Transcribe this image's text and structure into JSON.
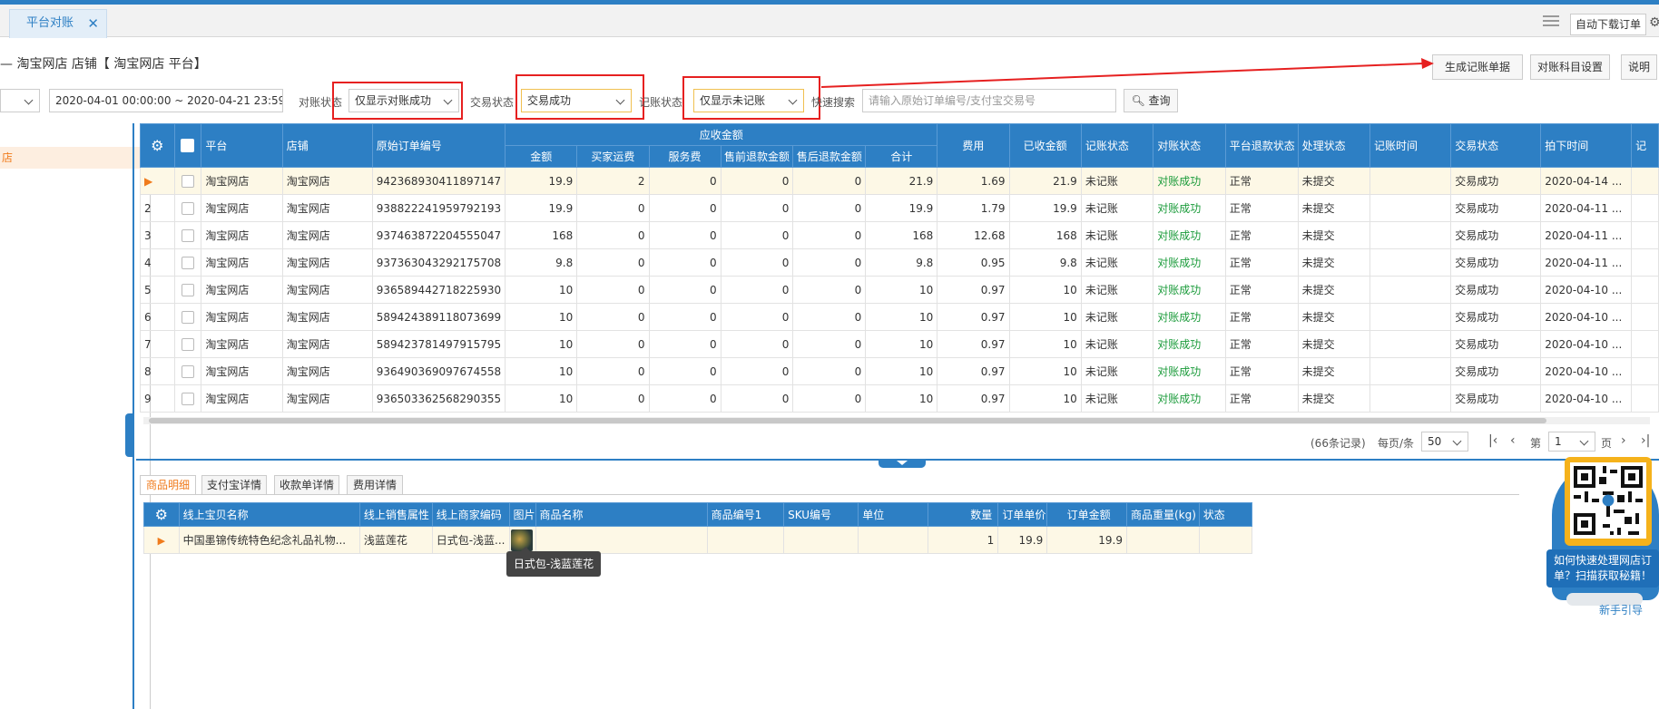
{
  "tabbar": {
    "active_tab": "平台对账",
    "close_glyph": "✕",
    "auto_download": "自动下载订单"
  },
  "breadcrumb": "— 淘宝网店 店铺【 淘宝网店 平台】",
  "toolbar": {
    "generate": "生成记账单据",
    "subject": "对账科目设置",
    "help": "说明"
  },
  "filters": {
    "date_range": "2020-04-01 00:00:00 ~ 2020-04-21 23:59:59",
    "recon_label": "对账状态",
    "recon_value": "仅显示对账成功",
    "trade_label": "交易状态",
    "trade_value": "交易成功",
    "account_label": "记账状态",
    "account_value": "仅显示未记账",
    "search_label": "快速搜索",
    "search_placeholder": "请输入原始订单编号/支付宝交易号",
    "query": "查询"
  },
  "left_panel": {
    "selected": "店"
  },
  "grid": {
    "group_header": "应收金额",
    "headers": {
      "platform": "平台",
      "shop": "店铺",
      "order_no": "原始订单编号",
      "amount": "金额",
      "freight": "买家运费",
      "service": "服务费",
      "pre_refund": "售前退款金额",
      "post_refund": "售后退款金额",
      "total": "合计",
      "fee": "费用",
      "received": "已收金额",
      "account_status": "记账状态",
      "recon_status": "对账状态",
      "refund_status": "平台退款状态",
      "process_status": "处理状态",
      "account_time": "记账时间",
      "trade_status": "交易状态",
      "order_time": "拍下时间",
      "extra": "记"
    },
    "rows": [
      {
        "no": "▶",
        "platform": "淘宝网店",
        "shop": "淘宝网店",
        "order_no": "942368930411897147",
        "amount": "19.9",
        "freight": "2",
        "service": "0",
        "pre_refund": "0",
        "post_refund": "0",
        "total": "21.9",
        "fee": "1.69",
        "received": "21.9",
        "account_status": "未记账",
        "recon_status": "对账成功",
        "refund_status": "正常",
        "process_status": "未提交",
        "account_time": "",
        "trade_status": "交易成功",
        "order_time": "2020-04-14 ..."
      },
      {
        "no": "2",
        "platform": "淘宝网店",
        "shop": "淘宝网店",
        "order_no": "938822241959792193",
        "amount": "19.9",
        "freight": "0",
        "service": "0",
        "pre_refund": "0",
        "post_refund": "0",
        "total": "19.9",
        "fee": "1.79",
        "received": "19.9",
        "account_status": "未记账",
        "recon_status": "对账成功",
        "refund_status": "正常",
        "process_status": "未提交",
        "account_time": "",
        "trade_status": "交易成功",
        "order_time": "2020-04-11 ..."
      },
      {
        "no": "3",
        "platform": "淘宝网店",
        "shop": "淘宝网店",
        "order_no": "937463872204555047",
        "amount": "168",
        "freight": "0",
        "service": "0",
        "pre_refund": "0",
        "post_refund": "0",
        "total": "168",
        "fee": "12.68",
        "received": "168",
        "account_status": "未记账",
        "recon_status": "对账成功",
        "refund_status": "正常",
        "process_status": "未提交",
        "account_time": "",
        "trade_status": "交易成功",
        "order_time": "2020-04-11 ..."
      },
      {
        "no": "4",
        "platform": "淘宝网店",
        "shop": "淘宝网店",
        "order_no": "937363043292175708",
        "amount": "9.8",
        "freight": "0",
        "service": "0",
        "pre_refund": "0",
        "post_refund": "0",
        "total": "9.8",
        "fee": "0.95",
        "received": "9.8",
        "account_status": "未记账",
        "recon_status": "对账成功",
        "refund_status": "正常",
        "process_status": "未提交",
        "account_time": "",
        "trade_status": "交易成功",
        "order_time": "2020-04-11 ..."
      },
      {
        "no": "5",
        "platform": "淘宝网店",
        "shop": "淘宝网店",
        "order_no": "936589442718225930",
        "amount": "10",
        "freight": "0",
        "service": "0",
        "pre_refund": "0",
        "post_refund": "0",
        "total": "10",
        "fee": "0.97",
        "received": "10",
        "account_status": "未记账",
        "recon_status": "对账成功",
        "refund_status": "正常",
        "process_status": "未提交",
        "account_time": "",
        "trade_status": "交易成功",
        "order_time": "2020-04-10 ..."
      },
      {
        "no": "6",
        "platform": "淘宝网店",
        "shop": "淘宝网店",
        "order_no": "589424389118073699",
        "amount": "10",
        "freight": "0",
        "service": "0",
        "pre_refund": "0",
        "post_refund": "0",
        "total": "10",
        "fee": "0.97",
        "received": "10",
        "account_status": "未记账",
        "recon_status": "对账成功",
        "refund_status": "正常",
        "process_status": "未提交",
        "account_time": "",
        "trade_status": "交易成功",
        "order_time": "2020-04-10 ..."
      },
      {
        "no": "7",
        "platform": "淘宝网店",
        "shop": "淘宝网店",
        "order_no": "589423781497915795",
        "amount": "10",
        "freight": "0",
        "service": "0",
        "pre_refund": "0",
        "post_refund": "0",
        "total": "10",
        "fee": "0.97",
        "received": "10",
        "account_status": "未记账",
        "recon_status": "对账成功",
        "refund_status": "正常",
        "process_status": "未提交",
        "account_time": "",
        "trade_status": "交易成功",
        "order_time": "2020-04-10 ..."
      },
      {
        "no": "8",
        "platform": "淘宝网店",
        "shop": "淘宝网店",
        "order_no": "936490369097674558",
        "amount": "10",
        "freight": "0",
        "service": "0",
        "pre_refund": "0",
        "post_refund": "0",
        "total": "10",
        "fee": "0.97",
        "received": "10",
        "account_status": "未记账",
        "recon_status": "对账成功",
        "refund_status": "正常",
        "process_status": "未提交",
        "account_time": "",
        "trade_status": "交易成功",
        "order_time": "2020-04-10 ..."
      },
      {
        "no": "9",
        "platform": "淘宝网店",
        "shop": "淘宝网店",
        "order_no": "936503362568290355",
        "amount": "10",
        "freight": "0",
        "service": "0",
        "pre_refund": "0",
        "post_refund": "0",
        "total": "10",
        "fee": "0.97",
        "received": "10",
        "account_status": "未记账",
        "recon_status": "对账成功",
        "refund_status": "正常",
        "process_status": "未提交",
        "account_time": "",
        "trade_status": "交易成功",
        "order_time": "2020-04-10 ..."
      }
    ]
  },
  "pager": {
    "records": "(66条记录)",
    "per_page_label": "每页/条",
    "per_page": "50",
    "page_label_pre": "第",
    "page": "1",
    "page_label_post": "页"
  },
  "bottom_tabs": [
    "商品明细",
    "支付宝详情",
    "收款单详情",
    "费用详情"
  ],
  "detail": {
    "headers": {
      "item_name": "线上宝贝名称",
      "sale_attr": "线上销售属性",
      "merchant_code": "线上商家编码",
      "image": "图片",
      "product_name": "商品名称",
      "product_no": "商品编号1",
      "sku": "SKU编号",
      "unit": "单位",
      "qty": "数量",
      "unit_price": "订单单价",
      "order_amount": "订单金额",
      "weight": "商品重量(kg)",
      "status": "状态"
    },
    "row": {
      "item_name": "中国墨锦传统特色纪念礼品礼物...",
      "sale_attr": "浅蓝莲花",
      "merchant_code": "日式包-浅蓝...",
      "product_name": "",
      "product_no": "",
      "sku": "",
      "unit": "",
      "qty": "1",
      "unit_price": "19.9",
      "order_amount": "19.9",
      "weight": "",
      "status": ""
    },
    "tooltip": "日式包-浅蓝莲花"
  },
  "qr_widget": {
    "text": "如何快速处理网店订单？扫描获取秘籍！",
    "newbie": "新手引导"
  },
  "colors": {
    "accent": "#2d7fc4",
    "highlight_row": "#fdf8e6",
    "success_text": "#1a9b3a",
    "annotation_red": "#e62020",
    "orange": "#f07b1c"
  }
}
